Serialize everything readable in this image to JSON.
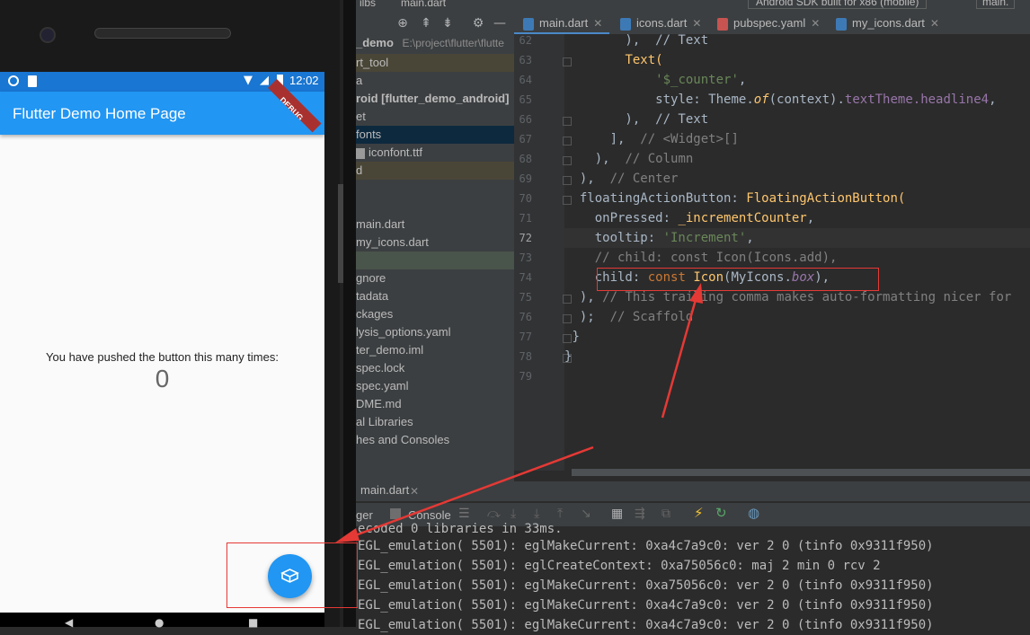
{
  "phone": {
    "status_time": "12:02",
    "debug_ribbon": "DEBUG",
    "app_title": "Flutter Demo Home Page",
    "counter_caption": "You have pushed the button this many times:",
    "counter_value": "0",
    "fab_icon": "box-icon"
  },
  "ide": {
    "top_strip_left": "ilbs",
    "top_strip_file": "main.dart",
    "top_strip_device": "Android SDK built for x86 (mobile)",
    "top_strip_right": "main.",
    "tabs": [
      {
        "label": "main.dart",
        "active": true
      },
      {
        "label": "icons.dart",
        "active": false
      },
      {
        "label": "pubspec.yaml",
        "active": false
      },
      {
        "label": "my_icons.dart",
        "active": false
      }
    ],
    "project_header": "_demo",
    "project_path": "E:\\project\\flutter\\flutte",
    "project_items": [
      "rt_tool",
      "a",
      "roid [flutter_demo_android]",
      "et",
      "fonts",
      "iconfont.ttf",
      "d",
      "",
      "",
      "main.dart",
      "my_icons.dart",
      "",
      "gnore",
      "tadata",
      "ckages",
      "lysis_options.yaml",
      "ter_demo.iml",
      "spec.lock",
      "spec.yaml",
      "DME.md",
      "al Libraries",
      "hes and Consoles"
    ],
    "line_numbers": [
      "62",
      "63",
      "64",
      "65",
      "66",
      "67",
      "68",
      "69",
      "70",
      "71",
      "72",
      "73",
      "74",
      "75",
      "76",
      "77",
      "78",
      "79"
    ],
    "code": {
      "l62": "        ),  // Text",
      "l63_indent": "        ",
      "l63": "Text(",
      "l64_str": "'$_counter'",
      "l65_a": "style: ",
      "l65_b": "Theme.",
      "l65_c": "of",
      "l65_d": "(context).",
      "l65_e": "textTheme.",
      "l65_f": "headline4",
      "l66": "        ),  // Text",
      "l67_a": "      ],  ",
      "l67_b": "// <Widget>[]",
      "l68_a": "    ),  ",
      "l68_b": "// Column",
      "l69_a": "  ),  ",
      "l69_b": "// Center",
      "l70_a": "floatingActionButton: ",
      "l70_b": "FloatingActionButton(",
      "l71_a": "onPressed: ",
      "l71_b": "_incrementCounter",
      "l72_a": "tooltip: ",
      "l72_b": "'Increment'",
      "l73": "// child: const Icon(Icons.add),",
      "l74_a": "child: ",
      "l74_b": "const ",
      "l74_c": "Icon",
      "l74_d": "(MyIcons.",
      "l74_e": "box",
      "l74_f": "),",
      "l75_a": "), ",
      "l75_b": "// This trailing comma makes auto-formatting nicer for",
      "l76_a": ");  ",
      "l76_b": "// Scaffold",
      "l77": "}",
      "l78": "}"
    },
    "run_tab": "main.dart",
    "console_tab_left": "ger",
    "console_tab": "Console",
    "console_lines": [
      "ecoded 0 libraries in 33ms.",
      "EGL_emulation( 5501): eglMakeCurrent: 0xa4c7a9c0: ver 2 0 (tinfo 0x9311f950)",
      "EGL_emulation( 5501): eglCreateContext: 0xa75056c0: maj 2 min 0 rcv 2",
      "EGL_emulation( 5501): eglMakeCurrent: 0xa75056c0: ver 2 0 (tinfo 0x9311f950)",
      "EGL_emulation( 5501): eglMakeCurrent: 0xa4c7a9c0: ver 2 0 (tinfo 0x9311f950)",
      "EGL_emulation( 5501): eglMakeCurrent: 0xa4c7a9c0: ver 2 0 (tinfo 0x9311f950)"
    ]
  },
  "colors": {
    "accent": "#2196f3",
    "annotation": "#e53935"
  }
}
